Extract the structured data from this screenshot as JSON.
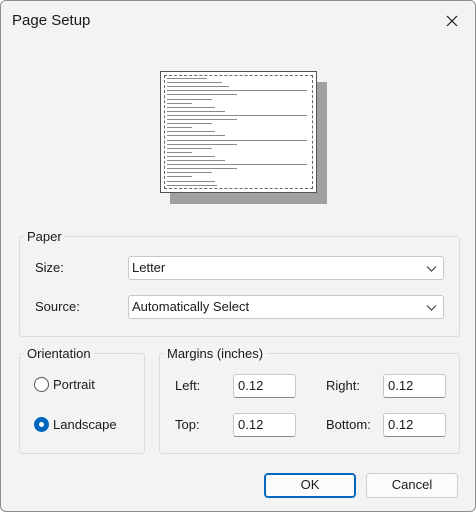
{
  "window": {
    "title": "Page Setup"
  },
  "paper": {
    "legend": "Paper",
    "size_label": "Size:",
    "size_value": "Letter",
    "source_label": "Source:",
    "source_value": "Automatically Select"
  },
  "orientation": {
    "legend": "Orientation",
    "portrait_label": "Portrait",
    "landscape_label": "Landscape",
    "selected": "Landscape"
  },
  "margins": {
    "legend": "Margins (inches)",
    "left_label": "Left:",
    "left_value": "0.12",
    "right_label": "Right:",
    "right_value": "0.12",
    "top_label": "Top:",
    "top_value": "0.12",
    "bottom_label": "Bottom:",
    "bottom_value": "0.12"
  },
  "buttons": {
    "ok": "OK",
    "cancel": "Cancel"
  },
  "icons": {
    "close": "close-icon",
    "dropdown": "chevron-down-icon"
  },
  "colors": {
    "accent": "#0067c0"
  }
}
